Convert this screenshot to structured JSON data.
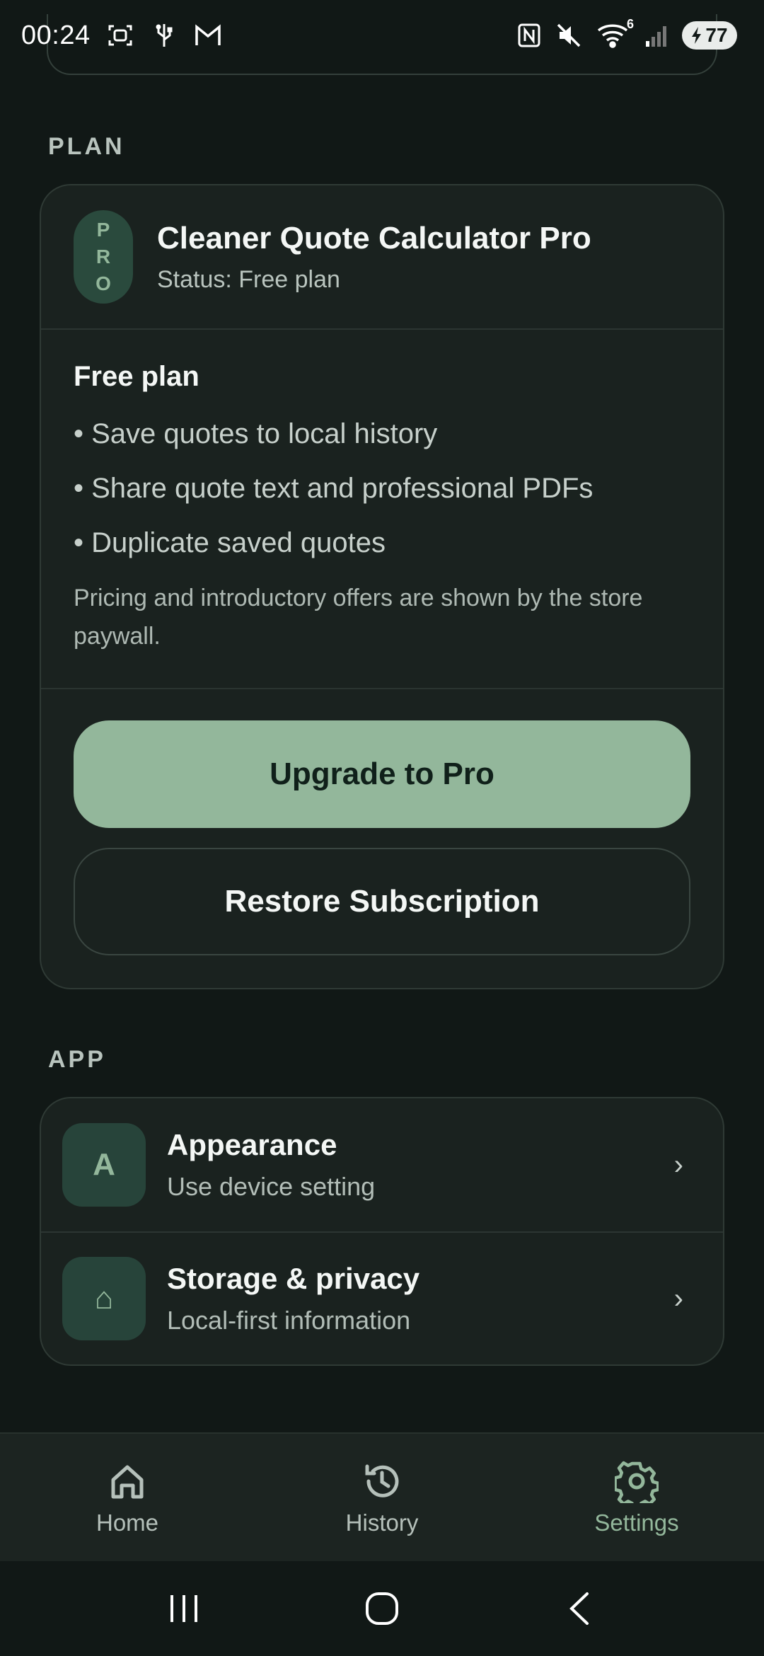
{
  "status_bar": {
    "time": "00:24",
    "battery": "77",
    "signal_badge": "6",
    "left_icons": [
      "screenshot-icon",
      "usb-icon",
      "gmail-icon"
    ],
    "right_icons": [
      "nfc-icon",
      "mute-icon",
      "wifi-icon",
      "signal-icon",
      "battery-icon"
    ]
  },
  "plan_section": {
    "title": "PLAN",
    "badge_letters": [
      "P",
      "R",
      "O"
    ],
    "product_name": "Cleaner Quote Calculator Pro",
    "status": "Status: Free plan",
    "plan_name": "Free plan",
    "features": [
      "• Save quotes to local history",
      "• Share quote text and professional PDFs",
      "• Duplicate saved quotes"
    ],
    "note": "Pricing and introductory offers are shown by the store paywall.",
    "upgrade_label": "Upgrade to Pro",
    "restore_label": "Restore Subscription"
  },
  "app_section": {
    "title": "APP",
    "items": [
      {
        "icon": "A",
        "title": "Appearance",
        "subtitle": "Use device setting",
        "chevron": "›"
      },
      {
        "icon": "⌂",
        "title": "Storage & privacy",
        "subtitle": "Local-first information",
        "chevron": "›"
      }
    ]
  },
  "bottom_nav": {
    "items": [
      {
        "label": "Home",
        "icon": "home-icon",
        "active": false
      },
      {
        "label": "History",
        "icon": "history-icon",
        "active": false
      },
      {
        "label": "Settings",
        "icon": "gear-icon",
        "active": true
      }
    ]
  },
  "colors": {
    "background": "#111816",
    "card": "#1a221f",
    "accent": "#93b79b",
    "badge_bg": "#2a4a3d"
  }
}
